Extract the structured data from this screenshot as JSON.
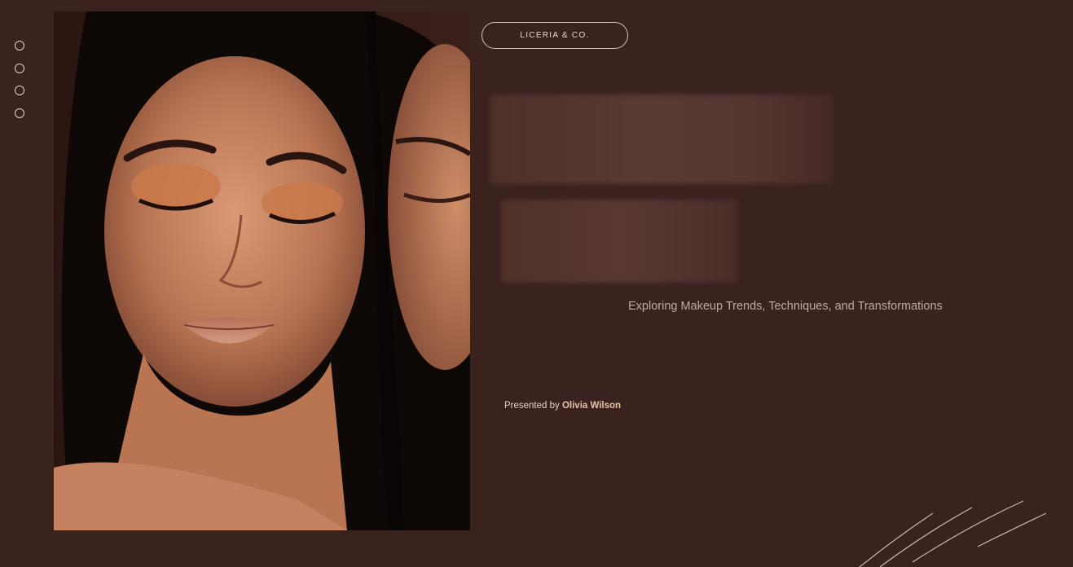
{
  "nav": {
    "dots": [
      "slide-1",
      "slide-2",
      "slide-3",
      "slide-4"
    ]
  },
  "brand": {
    "label": "LICERIA & CO."
  },
  "hero": {
    "subtitle": "Exploring Makeup Trends, Techniques, and Transformations",
    "presented_prefix": "Presented by",
    "presenter_name": "Olivia Wilson"
  },
  "colors": {
    "background": "#3a221e",
    "accent": "#eac3a8",
    "text_muted": "#bfa9a0"
  },
  "icons": {
    "nav_dot": "circle-outline-icon",
    "decoration": "curved-lines-icon"
  }
}
